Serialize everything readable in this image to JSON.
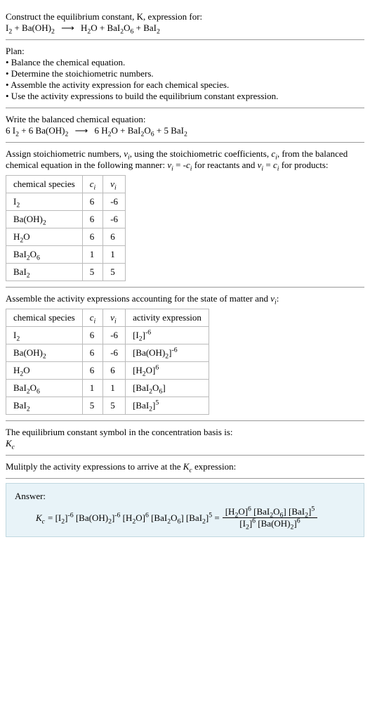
{
  "intro": {
    "line1": "Construct the equilibrium constant, K, expression for:",
    "eq_lhs": "I₂ + Ba(OH)₂",
    "eq_rhs": "H₂O + BaI₂O₆ + BaI₂"
  },
  "plan": {
    "heading": "Plan:",
    "bullets": [
      "• Balance the chemical equation.",
      "• Determine the stoichiometric numbers.",
      "• Assemble the activity expression for each chemical species.",
      "• Use the activity expressions to build the equilibrium constant expression."
    ]
  },
  "balanced": {
    "heading": "Write the balanced chemical equation:",
    "lhs": "6 I₂ + 6 Ba(OH)₂",
    "rhs": "6 H₂O + BaI₂O₆ + 5 BaI₂"
  },
  "stoich": {
    "intro1": "Assign stoichiometric numbers, νᵢ, using the stoichiometric coefficients, cᵢ, from the balanced chemical equation in the following manner: νᵢ = -cᵢ for reactants and νᵢ = cᵢ for products:",
    "headers": {
      "c0": "chemical species",
      "c1": "cᵢ",
      "c2": "νᵢ"
    },
    "rows": [
      {
        "sp": "I₂",
        "c": "6",
        "v": "-6"
      },
      {
        "sp": "Ba(OH)₂",
        "c": "6",
        "v": "-6"
      },
      {
        "sp": "H₂O",
        "c": "6",
        "v": "6"
      },
      {
        "sp": "BaI₂O₆",
        "c": "1",
        "v": "1"
      },
      {
        "sp": "BaI₂",
        "c": "5",
        "v": "5"
      }
    ]
  },
  "activity": {
    "intro": "Assemble the activity expressions accounting for the state of matter and νᵢ:",
    "headers": {
      "c0": "chemical species",
      "c1": "cᵢ",
      "c2": "νᵢ",
      "c3": "activity expression"
    },
    "rows": [
      {
        "sp": "I₂",
        "c": "6",
        "v": "-6",
        "a": "[I₂]⁻⁶"
      },
      {
        "sp": "Ba(OH)₂",
        "c": "6",
        "v": "-6",
        "a": "[Ba(OH)₂]⁻⁶"
      },
      {
        "sp": "H₂O",
        "c": "6",
        "v": "6",
        "a": "[H₂O]⁶"
      },
      {
        "sp": "BaI₂O₆",
        "c": "1",
        "v": "1",
        "a": "[BaI₂O₆]"
      },
      {
        "sp": "BaI₂",
        "c": "5",
        "v": "5",
        "a": "[BaI₂]⁵"
      }
    ]
  },
  "symbol": {
    "line": "The equilibrium constant symbol in the concentration basis is:",
    "sym": "K_c"
  },
  "multiply": {
    "line": "Mulitply the activity expressions to arrive at the K_c expression:"
  },
  "answer": {
    "label": "Answer:",
    "kc": "K_c",
    "eq": "= [I₂]⁻⁶ [Ba(OH)₂]⁻⁶ [H₂O]⁶ [BaI₂O₆] [BaI₂]⁵ =",
    "num": "[H₂O]⁶ [BaI₂O₆] [BaI₂]⁵",
    "den": "[I₂]⁶ [Ba(OH)₂]⁶"
  }
}
